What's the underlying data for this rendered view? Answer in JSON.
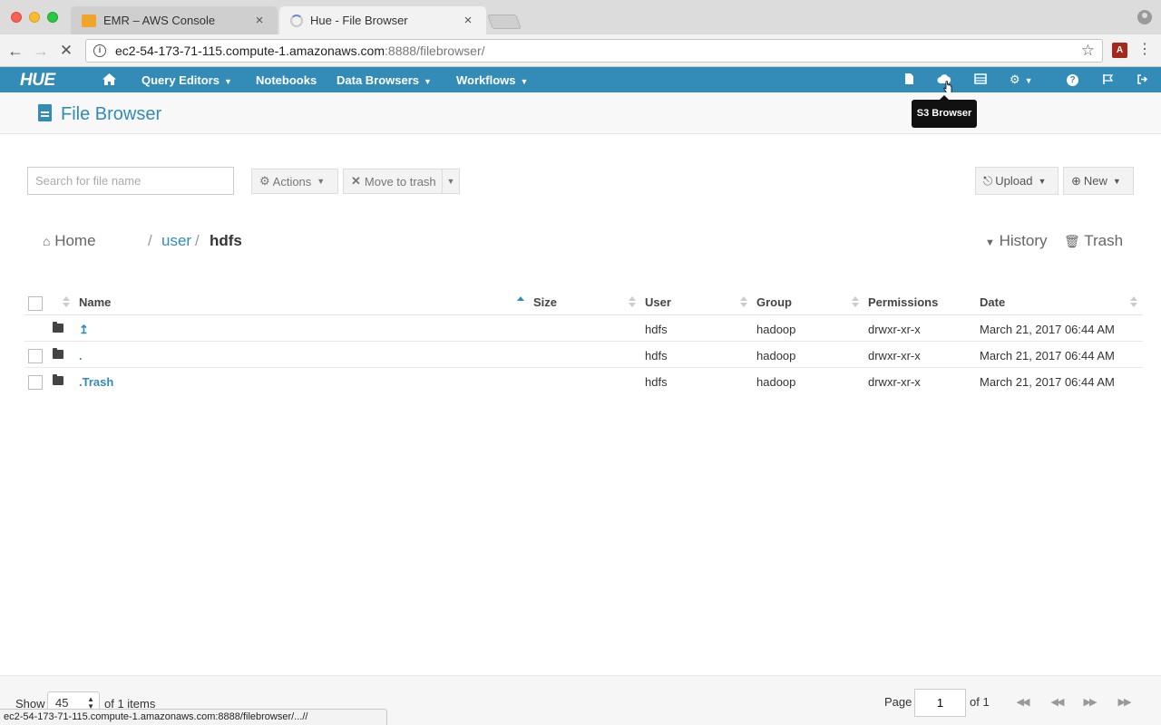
{
  "browser": {
    "tabs": [
      {
        "title": "EMR – AWS Console",
        "close": "×"
      },
      {
        "title": "Hue - File Browser",
        "close": "×"
      }
    ],
    "url_host": "ec2-54-173-71-115.compute-1.amazonaws.com",
    "url_path": ":8888/filebrowser/",
    "status_url": "ec2-54-173-71-115.compute-1.amazonaws.com:8888/filebrowser/...//"
  },
  "hue_nav": {
    "logo": "HUE",
    "items": [
      {
        "label": "Query Editors"
      },
      {
        "label": "Notebooks"
      },
      {
        "label": "Data Browsers"
      },
      {
        "label": "Workflows"
      }
    ],
    "tooltip": "S3 Browser"
  },
  "page": {
    "title": "File Browser"
  },
  "actions": {
    "search_placeholder": "Search for file name",
    "actions_label": "Actions",
    "trash_label": "Move to trash",
    "upload_label": "Upload",
    "new_label": "New"
  },
  "breadcrumb": {
    "home": "Home",
    "sep": "/",
    "user": "user",
    "current": "hdfs",
    "history": "History",
    "trash": "Trash"
  },
  "table": {
    "columns": [
      "Name",
      "Size",
      "User",
      "Group",
      "Permissions",
      "Date"
    ],
    "rows": [
      {
        "name": "↥",
        "size": "",
        "user": "hdfs",
        "group": "hadoop",
        "permissions": "drwxr-xr-x",
        "date": "March 21, 2017 06:44 AM"
      },
      {
        "name": ".",
        "size": "",
        "user": "hdfs",
        "group": "hadoop",
        "permissions": "drwxr-xr-x",
        "date": "March 21, 2017 06:44 AM"
      },
      {
        "name": ".Trash",
        "size": "",
        "user": "hdfs",
        "group": "hadoop",
        "permissions": "drwxr-xr-x",
        "date": "March 21, 2017 06:44 AM"
      }
    ]
  },
  "footer": {
    "show_label": "Show",
    "page_size": "45",
    "items_label": "of 1 items",
    "page_label": "Page",
    "page_value": "1",
    "of_label": "of 1"
  },
  "colors": {
    "brand": "#338bb8",
    "text": "#333333"
  }
}
